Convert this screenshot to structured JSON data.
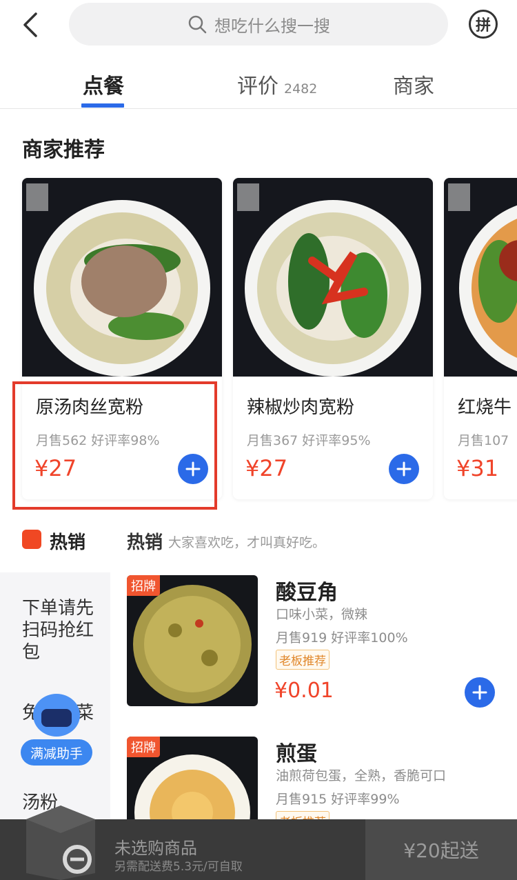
{
  "search": {
    "placeholder": "想吃什么搜一搜"
  },
  "header": {
    "pin_label": "拼"
  },
  "tabs": [
    {
      "label": "点餐",
      "active": true
    },
    {
      "label": "评价",
      "count": "2482"
    },
    {
      "label": "商家"
    }
  ],
  "recommend": {
    "title": "商家推荐",
    "items": [
      {
        "name": "原汤肉丝宽粉",
        "stats": "月售562  好评率98%",
        "price": "¥27"
      },
      {
        "name": "辣椒炒肉宽粉",
        "stats": "月售367  好评率95%",
        "price": "¥27"
      },
      {
        "name": "红烧牛",
        "stats": "月售107",
        "price": "¥31"
      }
    ]
  },
  "hot": {
    "category_label": "热销",
    "section_title": "热销",
    "section_desc": "大家喜欢吃，才叫真好吃。"
  },
  "sidebar": {
    "items": [
      "下单请先扫码抢红包",
      "免费小菜",
      "汤粉"
    ]
  },
  "assistant": {
    "label": "满减助手"
  },
  "products": [
    {
      "badge": "招牌",
      "name": "酸豆角",
      "desc": "口味小菜，微辣",
      "stats": "月售919  好评率100%",
      "tag": "老板推荐",
      "price": "¥0.01"
    },
    {
      "badge": "招牌",
      "name": "煎蛋",
      "desc": "油煎荷包蛋，全熟，香脆可口",
      "stats": "月售915  好评率99%",
      "tag": "老板推荐"
    }
  ],
  "cart": {
    "label": "未选购商品",
    "sub": "另需配送费5.3元/可自取",
    "min_order": "¥20起送"
  },
  "colors": {
    "accent": "#2b6ae8",
    "price": "#f0442a",
    "highlight": "#e33b2b"
  }
}
